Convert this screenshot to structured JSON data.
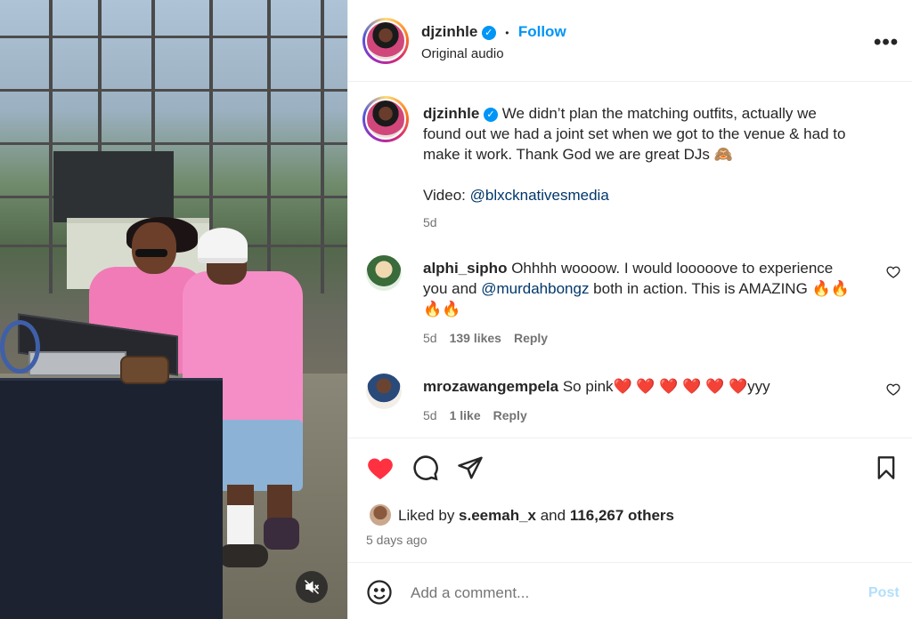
{
  "post": {
    "username": "djzinhle",
    "follow_label": "Follow",
    "separator": "•",
    "audio_label": "Original audio",
    "more_label": "•••"
  },
  "caption": {
    "username": "djzinhle",
    "text_line1": "We didn’t plan the matching outfits, actually we",
    "text_line2": "found out we had a joint set when we got to the venue & had to",
    "text_line3": "make it work. Thank God we are great DJs 🙈",
    "video_prefix": "Video: ",
    "video_mention": "@blxcknativesmedia",
    "time": "5d"
  },
  "comments": [
    {
      "username": "alphi_sipho",
      "text_a": "Ohhhh woooow. I would looooove to experience",
      "text_b_prefix": "you and ",
      "text_b_mention": "@murdahbongz",
      "text_b_suffix": " both in action. This is AMAZING 🔥🔥",
      "text_c": "🔥🔥",
      "time": "5d",
      "likes": "139 likes",
      "reply": "Reply"
    },
    {
      "username": "mrozawangempela",
      "text": "So pink❤️ ❤️ ❤️ ❤️ ❤️ ❤️yyy",
      "time": "5d",
      "likes": "1 like",
      "reply": "Reply"
    }
  ],
  "engagement": {
    "liked_by_prefix": "Liked by ",
    "liked_by_user": "s.eemah_x",
    "liked_by_mid": " and ",
    "liked_by_count": "116,267 others",
    "posted_ago": "5 days ago"
  },
  "comment_input": {
    "placeholder": "Add a comment...",
    "post_label": "Post"
  },
  "colors": {
    "accent": "#0095f6",
    "like_red": "#ff3040",
    "mention": "#00376b",
    "muted": "#737373"
  }
}
